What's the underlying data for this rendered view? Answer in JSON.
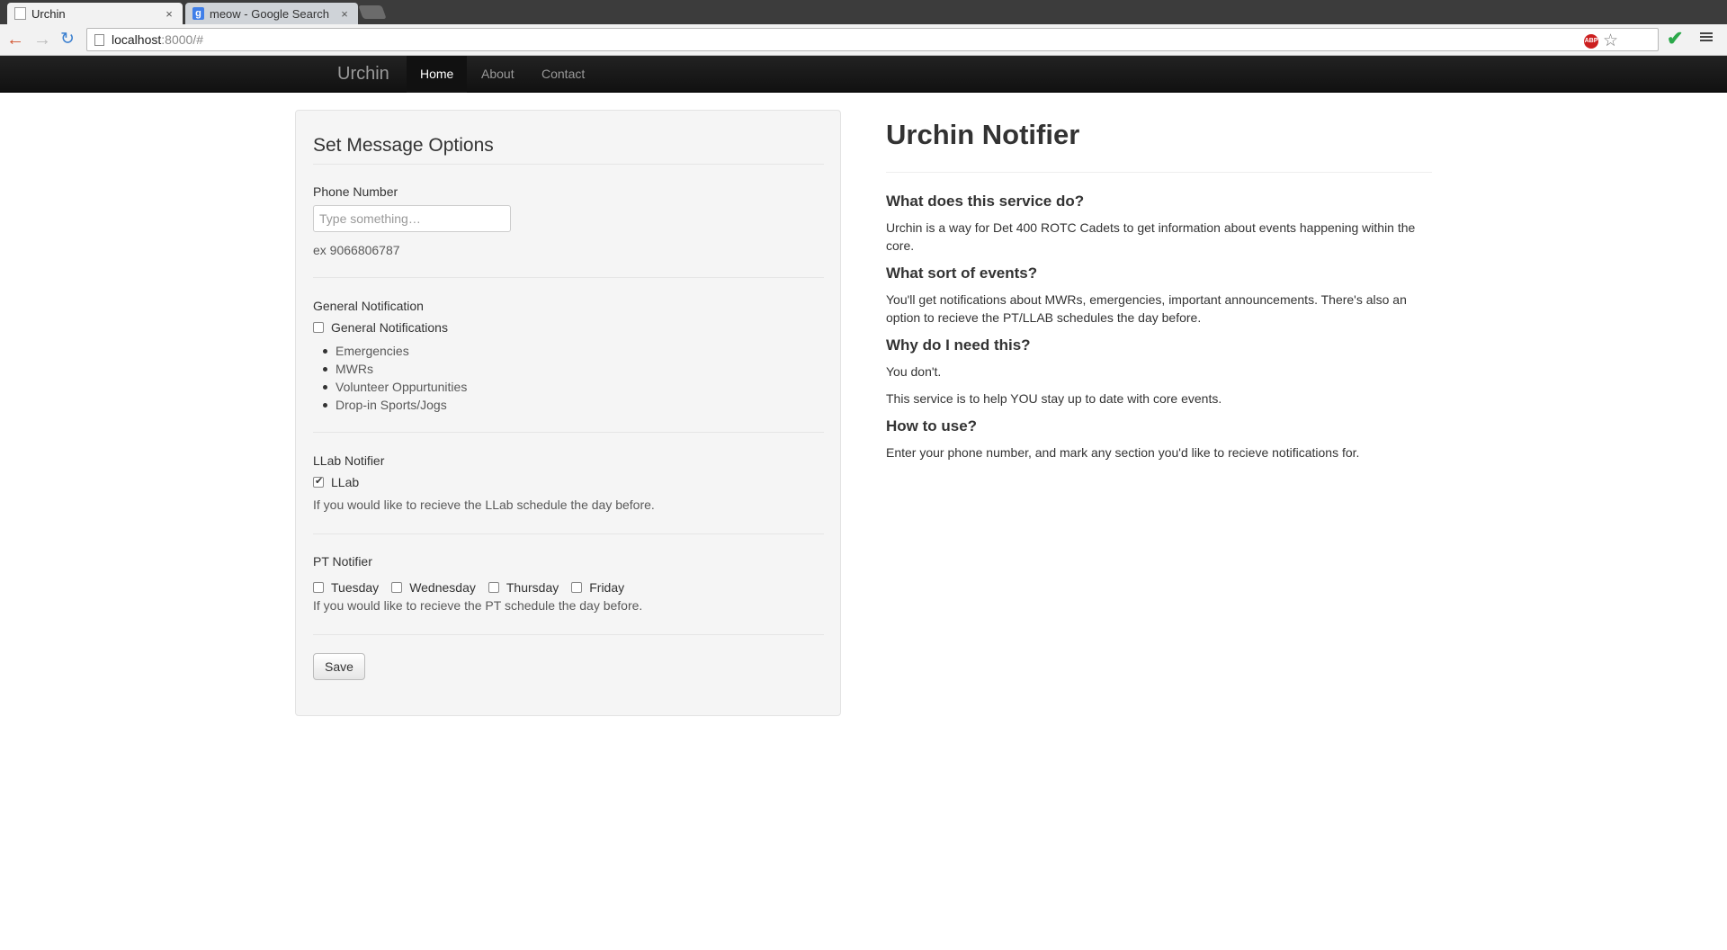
{
  "browser": {
    "tabs": [
      {
        "title": "Urchin",
        "active": true
      },
      {
        "title": "meow - Google Search",
        "active": false
      }
    ],
    "url_host": "localhost",
    "url_rest": ":8000/#",
    "abp_label": "ABP",
    "icons": {
      "back": "←",
      "forward": "→",
      "reload": "↻",
      "star": "☆",
      "check": "✔",
      "close": "×",
      "google": "g"
    }
  },
  "navbar": {
    "brand": "Urchin",
    "links": [
      "Home",
      "About",
      "Contact"
    ],
    "active": "Home"
  },
  "form": {
    "legend": "Set Message Options",
    "phone": {
      "label": "Phone Number",
      "placeholder": "Type something…",
      "help": "ex 9066806787"
    },
    "general": {
      "label": "General Notification",
      "checkbox_label": "General Notifications",
      "checked": false,
      "items": [
        "Emergencies",
        "MWRs",
        "Volunteer Oppurtunities",
        "Drop-in Sports/Jogs"
      ]
    },
    "llab": {
      "label": "LLab Notifier",
      "checkbox_label": "LLab",
      "checked": true,
      "help": "If you would like to recieve the LLab schedule the day before."
    },
    "pt": {
      "label": "PT Notifier",
      "days": [
        {
          "label": "Tuesday",
          "checked": false
        },
        {
          "label": "Wednesday",
          "checked": false
        },
        {
          "label": "Thursday",
          "checked": false
        },
        {
          "label": "Friday",
          "checked": false
        }
      ],
      "help": "If you would like to recieve the PT schedule the day before."
    },
    "save_label": "Save"
  },
  "info": {
    "title": "Urchin Notifier",
    "sections": [
      {
        "q": "What does this service do?",
        "a": [
          "Urchin is a way for Det 400 ROTC Cadets to get information about events happening within the core."
        ]
      },
      {
        "q": "What sort of events?",
        "a": [
          "You'll get notifications about MWRs, emergencies, important announcements. There's also an option to recieve the PT/LLAB schedules the day before."
        ]
      },
      {
        "q": "Why do I need this?",
        "a": [
          "You don't.",
          "This service is to help YOU stay up to date with core events."
        ]
      },
      {
        "q": "How to use?",
        "a": [
          "Enter your phone number, and mark any section you'd like to recieve notifications for."
        ]
      }
    ]
  }
}
